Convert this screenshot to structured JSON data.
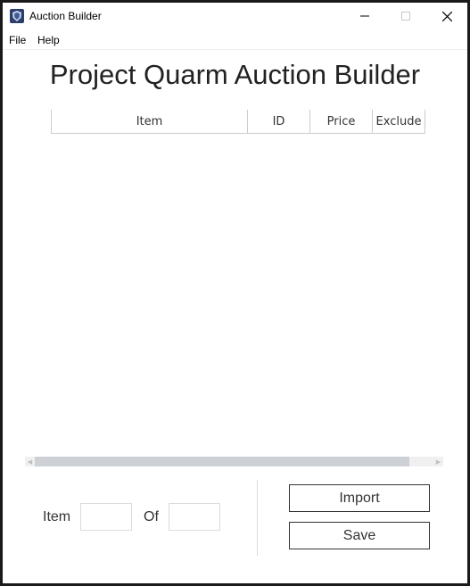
{
  "window": {
    "title": "Auction Builder",
    "icon": "shield-app-icon",
    "controls": {
      "minimize": "─",
      "maximize": "☐",
      "close": "✕"
    }
  },
  "menu": {
    "file": "File",
    "help": "Help"
  },
  "main": {
    "heading": "Project Quarm Auction Builder",
    "table": {
      "columns": [
        "Item",
        "ID",
        "Price",
        "Exclude"
      ],
      "rows": []
    }
  },
  "footer": {
    "item_label": "Item",
    "item_value": "",
    "of_label": "Of",
    "of_value": "",
    "import_label": "Import",
    "save_label": "Save"
  },
  "colors": {
    "scroll_thumb": "#cdd0d4",
    "border": "#cccccc"
  }
}
